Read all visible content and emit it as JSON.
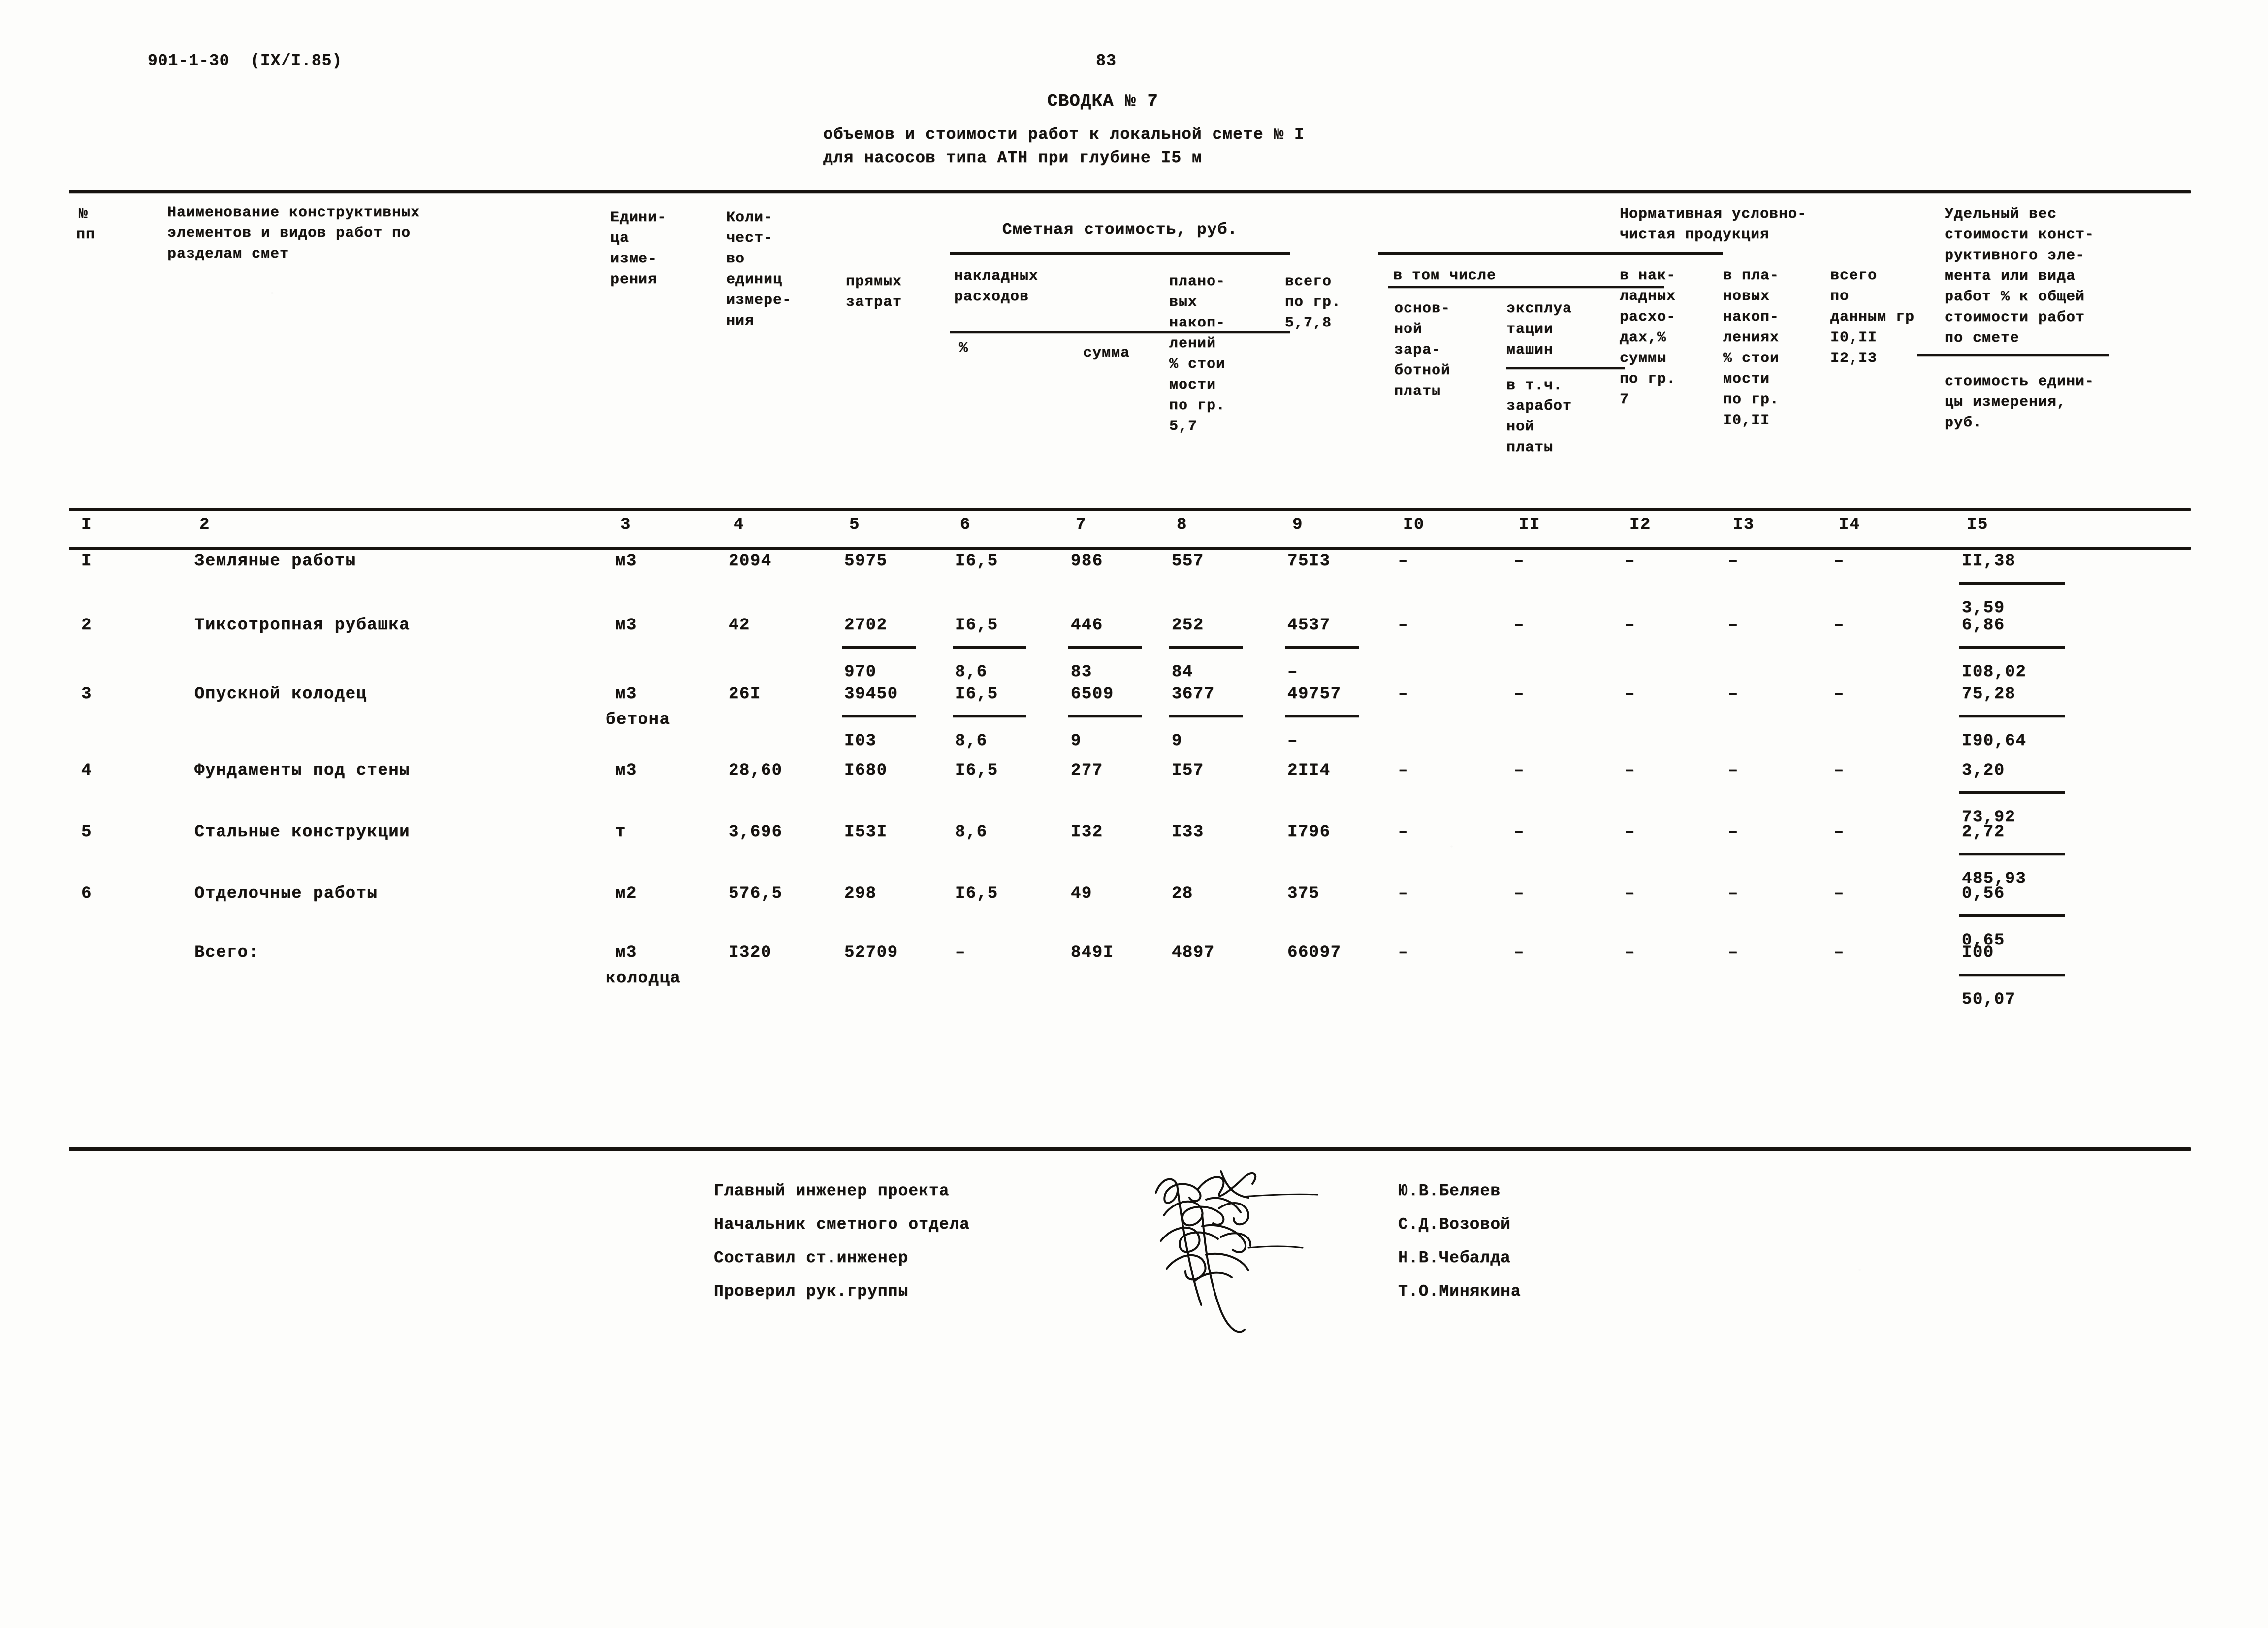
{
  "document": {
    "code_header": "901-1-30  (IX/I.85)",
    "page_number": "83",
    "title": "СВОДКА № 7",
    "subtitle_line1": "объемов и стоимости работ к локальной смете № I",
    "subtitle_line2": "для насосов типа АТН при глубине I5 м"
  },
  "table_header": {
    "col1_line1": "№",
    "col1_line2": "пп",
    "col2_line1": "Наименование конструктивных",
    "col2_line2": "элементов и видов работ по",
    "col2_line3": "разделам смет",
    "col3_line1": "Едини-",
    "col3_line2": "ца",
    "col3_line3": "изме-",
    "col3_line4": "рения",
    "col4_line1": "Коли-",
    "col4_line2": "чест-",
    "col4_line3": "во",
    "col4_line4": "единиц",
    "col4_line5": "измере-",
    "col4_line6": "ния",
    "group_smetnaya": "Сметная стоимость, руб.",
    "col5_line1": "прямых",
    "col5_line2": "затрат",
    "col6_7_title_line1": "накладных",
    "col6_7_title_line2": "расходов",
    "col6_pct": "%",
    "col7_summa": "сумма",
    "col8_line1": "плано-",
    "col8_line2": "вых",
    "col8_line3": "накоп-",
    "col8_line4": "лений",
    "col8_line5": "% стои",
    "col8_line6": "мости",
    "col8_line7": "по гр.",
    "col8_line8": "5,7",
    "col9_line1": "всего",
    "col9_line2": "по гр.",
    "col9_line3": "5,7,8",
    "group_normativ_line1": "Нормативная условно-",
    "group_normativ_line2": "чистая продукция",
    "vtomchisle": "в том числе",
    "col10_line1": "основ-",
    "col10_line2": "ной",
    "col10_line3": "зара-",
    "col10_line4": "ботной",
    "col10_line5": "платы",
    "col11_line1": "эксплуа",
    "col11_line2": "тации",
    "col11_line3": "машин",
    "col11_line4": "в т.ч.",
    "col11_line5": "заработ",
    "col11_line6": "ной",
    "col11_line7": "платы",
    "col12_line1": "в нак-",
    "col12_line2": "ладных",
    "col12_line3": "расхо-",
    "col12_line4": "дах,%",
    "col12_line5": "суммы",
    "col12_line6": "по гр.",
    "col12_line7": "7",
    "col13_line1": "в пла-",
    "col13_line2": "новых",
    "col13_line3": "накоп-",
    "col13_line4": "лениях",
    "col13_line5": "% стои",
    "col13_line6": "мости",
    "col13_line7": "по гр.",
    "col13_line8": "I0,II",
    "col14_line1": "всего",
    "col14_line2": "по",
    "col14_line3": "данным гр",
    "col14_line4": "I0,II",
    "col14_line5": "I2,I3",
    "col15_line1": "Удельный вес",
    "col15_line2": "стоимости конст-",
    "col15_line3": "руктивного эле-",
    "col15_line4": "мента или вида",
    "col15_line5": "работ % к общей",
    "col15_line6": "стоимости работ",
    "col15_line7": "по смете",
    "col15_line8": "стоимость едини-",
    "col15_line9": "цы измерения,",
    "col15_line10": "руб."
  },
  "column_numbers": [
    "I",
    "2",
    "3",
    "4",
    "5",
    "6",
    "7",
    "8",
    "9",
    "I0",
    "II",
    "I2",
    "I3",
    "I4",
    "I5"
  ],
  "rows": [
    {
      "no": "I",
      "name": "Земляные работы",
      "unit": "м3",
      "unit2": "",
      "qty": "2094",
      "direct_top": "5975",
      "direct_bot": "",
      "oh_pct_top": "I6,5",
      "oh_pct_bot": "",
      "oh_sum_top": "986",
      "oh_sum_bot": "",
      "plan_top": "557",
      "plan_bot": "",
      "total_top": "75I3",
      "total_bot": "",
      "c10": "–",
      "c11": "–",
      "c12": "–",
      "c13": "–",
      "c14": "–",
      "share_pct": "II,38",
      "unit_cost": "3,59"
    },
    {
      "no": "2",
      "name": "Тиксотропная рубашка",
      "unit": "м3",
      "unit2": "",
      "qty": "42",
      "direct_top": "2702",
      "direct_bot": "970",
      "oh_pct_top": "I6,5",
      "oh_pct_bot": "8,6",
      "oh_sum_top": "446",
      "oh_sum_bot": "83",
      "plan_top": "252",
      "plan_bot": "84",
      "total_top": "4537",
      "total_bot": "–",
      "c10": "–",
      "c11": "–",
      "c12": "–",
      "c13": "–",
      "c14": "–",
      "share_pct": "6,86",
      "unit_cost": "I08,02"
    },
    {
      "no": "3",
      "name": "Опускной колодец",
      "unit": "м3",
      "unit2": "бетона",
      "qty": "26I",
      "direct_top": "39450",
      "direct_bot": "I03",
      "oh_pct_top": "I6,5",
      "oh_pct_bot": "8,6",
      "oh_sum_top": "6509",
      "oh_sum_bot": "9",
      "plan_top": "3677",
      "plan_bot": "9",
      "total_top": "49757",
      "total_bot": "–",
      "c10": "–",
      "c11": "–",
      "c12": "–",
      "c13": "–",
      "c14": "–",
      "share_pct": "75,28",
      "unit_cost": "I90,64"
    },
    {
      "no": "4",
      "name": "Фундаменты под стены",
      "unit": "м3",
      "unit2": "",
      "qty": "28,60",
      "direct_top": "I680",
      "direct_bot": "",
      "oh_pct_top": "I6,5",
      "oh_pct_bot": "",
      "oh_sum_top": "277",
      "oh_sum_bot": "",
      "plan_top": "I57",
      "plan_bot": "",
      "total_top": "2II4",
      "total_bot": "",
      "c10": "–",
      "c11": "–",
      "c12": "–",
      "c13": "–",
      "c14": "–",
      "share_pct": "3,20",
      "unit_cost": "73,92"
    },
    {
      "no": "5",
      "name": "Стальные конструкции",
      "unit": "т",
      "unit2": "",
      "qty": "3,696",
      "direct_top": "I53I",
      "direct_bot": "",
      "oh_pct_top": "8,6",
      "oh_pct_bot": "",
      "oh_sum_top": "I32",
      "oh_sum_bot": "",
      "plan_top": "I33",
      "plan_bot": "",
      "total_top": "I796",
      "total_bot": "",
      "c10": "–",
      "c11": "–",
      "c12": "–",
      "c13": "–",
      "c14": "–",
      "share_pct": "2,72",
      "unit_cost": "485,93"
    },
    {
      "no": "6",
      "name": "Отделочные работы",
      "unit": "м2",
      "unit2": "",
      "qty": "576,5",
      "direct_top": "298",
      "direct_bot": "",
      "oh_pct_top": "I6,5",
      "oh_pct_bot": "",
      "oh_sum_top": "49",
      "oh_sum_bot": "",
      "plan_top": "28",
      "plan_bot": "",
      "total_top": "375",
      "total_bot": "",
      "c10": "–",
      "c11": "–",
      "c12": "–",
      "c13": "–",
      "c14": "–",
      "share_pct": "0,56",
      "unit_cost": "0,65"
    },
    {
      "no": "",
      "name": "Всего:",
      "unit": "м3",
      "unit2": "колодца",
      "qty": "I320",
      "direct_top": "52709",
      "direct_bot": "",
      "oh_pct_top": "–",
      "oh_pct_bot": "",
      "oh_sum_top": "849I",
      "oh_sum_bot": "",
      "plan_top": "4897",
      "plan_bot": "",
      "total_top": "66097",
      "total_bot": "",
      "c10": "–",
      "c11": "–",
      "c12": "–",
      "c13": "–",
      "c14": "–",
      "share_pct": "I00",
      "unit_cost": "50,07"
    }
  ],
  "signatures": {
    "roles": [
      "Главный инженер проекта",
      "Начальник сметного отдела",
      "Составил ст.инженер",
      "Проверил рук.группы"
    ],
    "names": [
      "Ю.В.Беляев",
      "С.Д.Возовой",
      "Н.В.Чебалда",
      "Т.О.Минякина"
    ]
  }
}
